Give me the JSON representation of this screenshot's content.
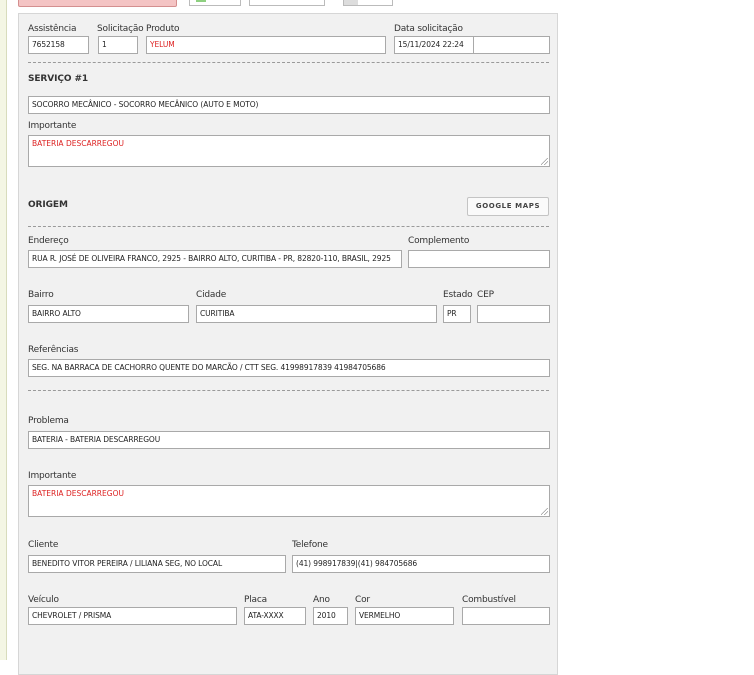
{
  "form": {
    "header": {
      "assistencia_label": "Assistência",
      "assistencia_value": "7652158",
      "solicitacao_label": "Solicitação",
      "solicitacao_value": "1",
      "produto_label": "Produto",
      "produto_value": "YELUM",
      "data_label": "Data solicitação",
      "data_value": "15/11/2024 22:24",
      "data_extra_value": ""
    },
    "servico": {
      "title": "SERVIÇO #1",
      "servico_value": "SOCORRO MECÂNICO - SOCORRO MECÂNICO (AUTO E MOTO)",
      "importante_label": "Importante",
      "importante_value": "BATERIA DESCARREGOU"
    },
    "origem": {
      "title": "ORIGEM",
      "google_maps_button": "GOOGLE MAPS",
      "endereco_label": "Endereço",
      "endereco_value": "RUA R. JOSÉ DE OLIVEIRA FRANCO, 2925 - BAIRRO ALTO, CURITIBA - PR, 82820-110, BRASIL, 2925",
      "complemento_label": "Complemento",
      "complemento_value": "",
      "bairro_label": "Bairro",
      "bairro_value": "BAIRRO ALTO",
      "cidade_label": "Cidade",
      "cidade_value": "CURITIBA",
      "estado_label": "Estado",
      "estado_value": "PR",
      "cep_label": "CEP",
      "cep_value": "",
      "referencias_label": "Referências",
      "referencias_value": "SEG. NA BARRACA DE CACHORRO QUENTE DO MARCÃO / CTT SEG. 41998917839  41984705686"
    },
    "detalhes": {
      "problema_label": "Problema",
      "problema_value": "BATERIA - BATERIA DESCARREGOU",
      "importante_label": "Importante",
      "importante_value": "BATERIA DESCARREGOU",
      "cliente_label": "Cliente",
      "cliente_value": "BENEDITO VITOR PEREIRA / LILIANA SEG, NO LOCAL",
      "telefone_label": "Telefone",
      "telefone_value": "(41) 998917839|(41) 984705686",
      "veiculo_label": "Veículo",
      "veiculo_value": "CHEVROLET / PRISMA",
      "placa_label": "Placa",
      "placa_value": "ATA-XXXX",
      "ano_label": "Ano",
      "ano_value": "2010",
      "cor_label": "Cor",
      "cor_value": "VERMELHO",
      "combustivel_label": "Combustível",
      "combustivel_value": ""
    }
  }
}
